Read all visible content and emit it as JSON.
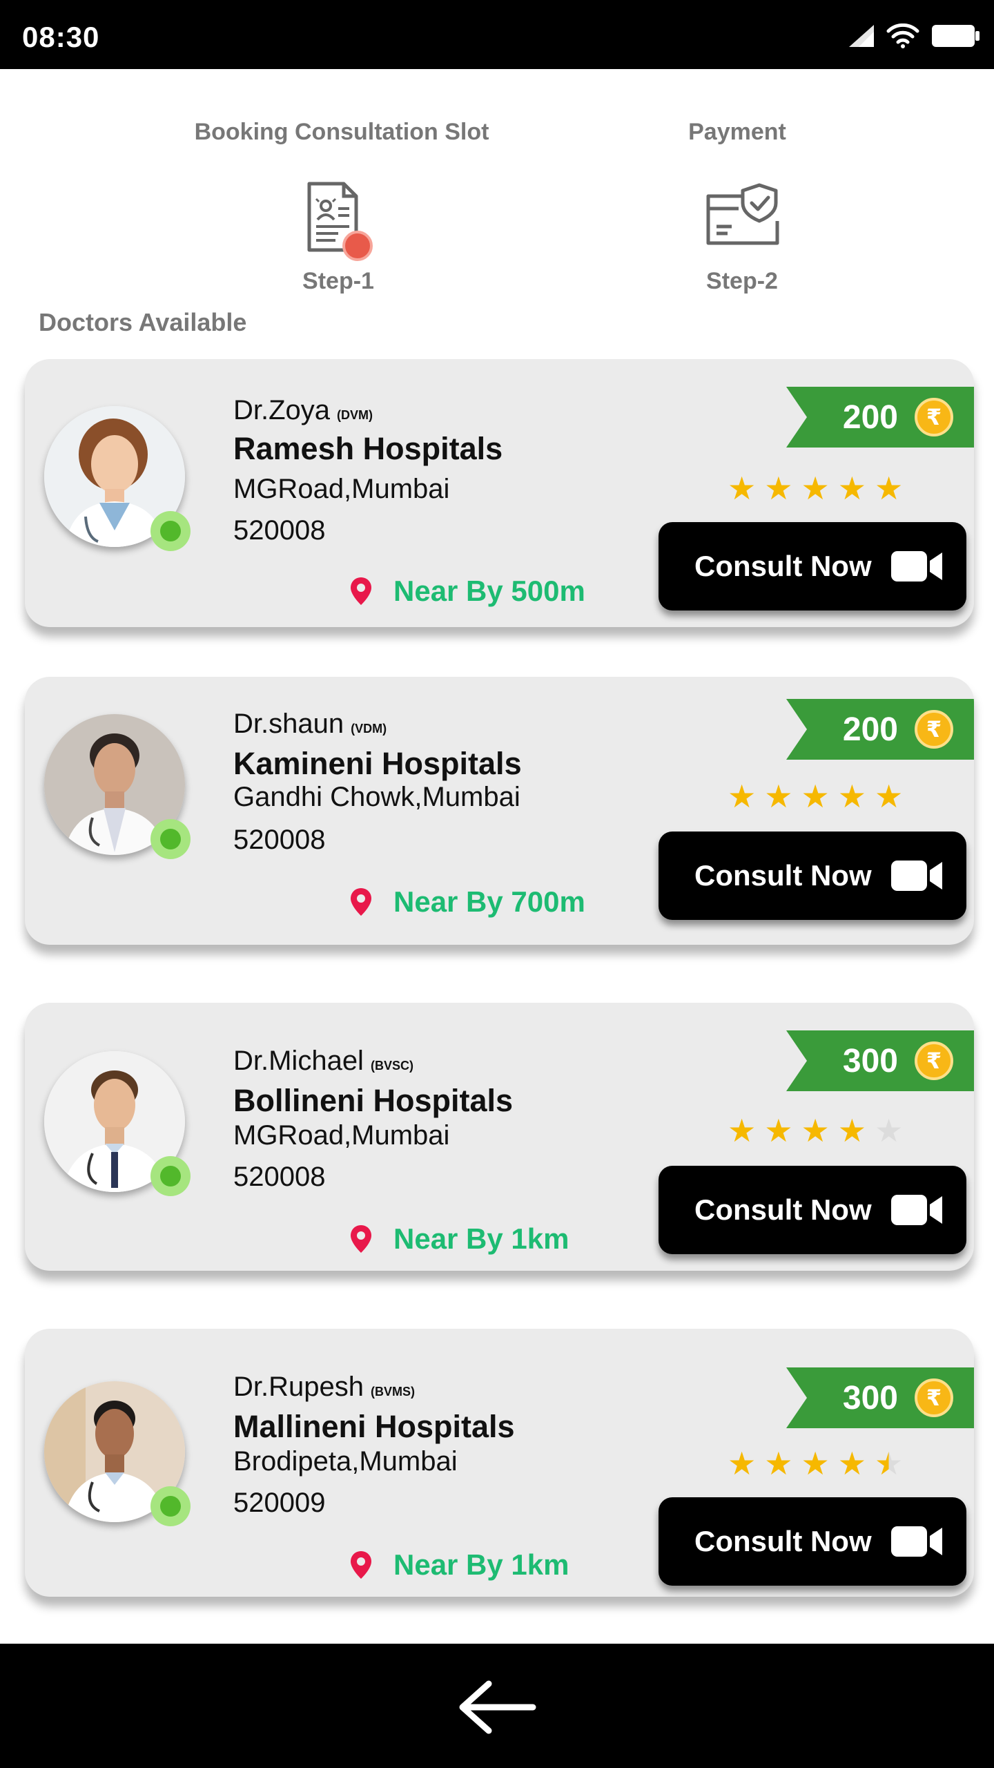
{
  "status_bar": {
    "time": "08:30"
  },
  "steps": [
    {
      "title": "Booking Consultation Slot",
      "label": "Step-1",
      "icon": "document-user-icon"
    },
    {
      "title": "Payment",
      "label": "Step-2",
      "icon": "payment-shield-icon"
    }
  ],
  "section_title": "Doctors Available",
  "doctors": [
    {
      "name": "Dr.Zoya",
      "degree": "(DVM)",
      "hospital": "Ramesh Hospitals",
      "address": "MGRoad,Mumbai",
      "pincode": "520008",
      "distance": "Near By 500m",
      "price": "200",
      "rating": 5,
      "consult_label": "Consult Now",
      "online": true
    },
    {
      "name": "Dr.shaun",
      "degree": "(VDM)",
      "hospital": "Kamineni Hospitals",
      "address": "Gandhi Chowk,Mumbai",
      "pincode": "520008",
      "distance": "Near By 700m",
      "price": "200",
      "rating": 5,
      "consult_label": "Consult Now",
      "online": true
    },
    {
      "name": "Dr.Michael",
      "degree": "(BVSC)",
      "hospital": "Bollineni Hospitals",
      "address": "MGRoad,Mumbai",
      "pincode": "520008",
      "distance": "Near By 1km",
      "price": "300",
      "rating": 4,
      "consult_label": "Consult Now",
      "online": true
    },
    {
      "name": "Dr.Rupesh",
      "degree": "(BVMS)",
      "hospital": "Mallineni Hospitals",
      "address": "Brodipeta,Mumbai",
      "pincode": "520009",
      "distance": "Near By 1km",
      "price": "300",
      "rating": 4.5,
      "consult_label": "Consult Now",
      "online": true
    }
  ],
  "colors": {
    "accent_green": "#3a9b3a",
    "distance_green": "#1dbb72",
    "star_gold": "#f6b800",
    "location_pin": "#e8184a",
    "step_dot": "#e85a4a",
    "online_dot": "#52b82b"
  }
}
